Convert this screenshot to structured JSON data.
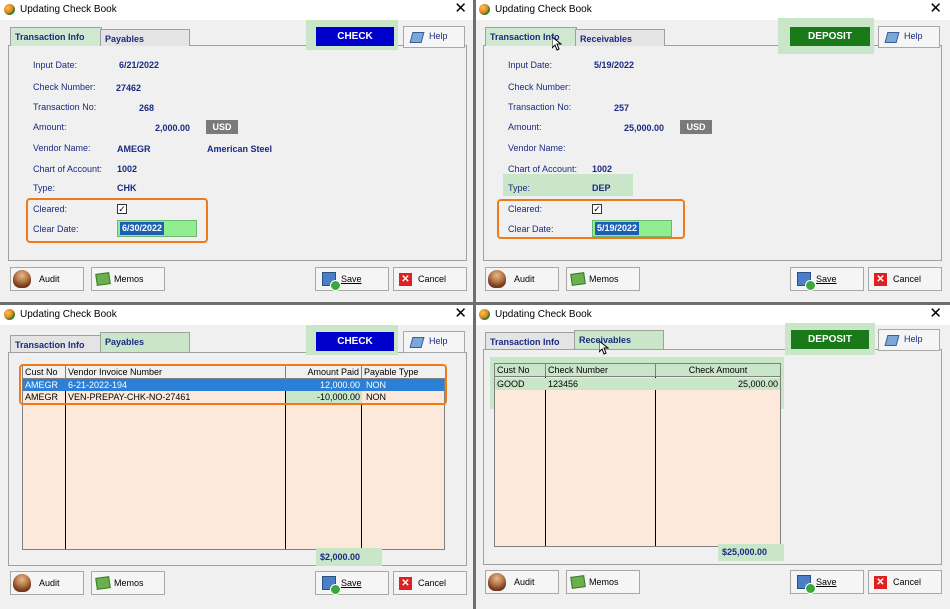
{
  "windows": [
    {
      "title": "Updating Check Book",
      "close": "✕",
      "tabs": [
        "Transaction Info",
        "Payables"
      ],
      "badge": "CHECK",
      "help": "Help",
      "fields": {
        "input_date_label": "Input Date:",
        "input_date": "6/21/2022",
        "check_number_label": "Check Number:",
        "check_number": "27462",
        "transaction_no_label": "Transaction No:",
        "transaction_no": "268",
        "amount_label": "Amount:",
        "amount": "2,000.00",
        "currency": "USD",
        "vendor_name_label": "Vendor Name:",
        "vendor_code": "AMEGR",
        "vendor_name": "American Steel",
        "chart_of_account_label": "Chart of Account:",
        "chart_of_account": "1002",
        "type_label": "Type:",
        "type": "CHK",
        "cleared_label": "Cleared:",
        "cleared": "✓",
        "clear_date_label": "Clear Date:",
        "clear_date": "6/30/2022"
      },
      "buttons": {
        "audit": "Audit",
        "memos": "Memos",
        "save": "Save",
        "cancel": "Cancel"
      }
    },
    {
      "title": "Updating Check Book",
      "close": "✕",
      "tabs": [
        "Transaction Info",
        "Receivables"
      ],
      "badge": "DEPOSIT",
      "help": "Help",
      "fields": {
        "input_date_label": "Input Date:",
        "input_date": "5/19/2022",
        "check_number_label": "Check Number:",
        "transaction_no_label": "Transaction No:",
        "transaction_no": "257",
        "amount_label": "Amount:",
        "amount": "25,000.00",
        "currency": "USD",
        "vendor_name_label": "Vendor Name:",
        "chart_of_account_label": "Chart of Account:",
        "chart_of_account": "1002",
        "type_label": "Type:",
        "type": "DEP",
        "cleared_label": "Cleared:",
        "cleared": "✓",
        "clear_date_label": "Clear Date:",
        "clear_date": "5/19/2022"
      },
      "buttons": {
        "audit": "Audit",
        "memos": "Memos",
        "save": "Save",
        "cancel": "Cancel"
      }
    },
    {
      "title": "Updating Check Book",
      "close": "✕",
      "tabs": [
        "Transaction Info",
        "Payables"
      ],
      "badge": "CHECK",
      "help": "Help",
      "grid": {
        "headers": [
          "Cust No",
          "Vendor Invoice Number",
          "Amount Paid",
          "Payable Type"
        ],
        "rows": [
          [
            "AMEGR",
            "6-21-2022-194",
            "12,000.00",
            "NON"
          ],
          [
            "AMEGR",
            "VEN-PREPAY-CHK-NO-27461",
            "-10,000.00",
            "NON"
          ]
        ],
        "total": "$2,000.00"
      },
      "buttons": {
        "audit": "Audit",
        "memos": "Memos",
        "save": "Save",
        "cancel": "Cancel"
      }
    },
    {
      "title": "Updating Check Book",
      "close": "✕",
      "tabs": [
        "Transaction Info",
        "Receivables"
      ],
      "badge": "DEPOSIT",
      "help": "Help",
      "grid": {
        "headers": [
          "Cust No",
          "Check Number",
          "Check Amount"
        ],
        "rows": [
          [
            "GOOD",
            "123456",
            "25,000.00"
          ]
        ],
        "total": "$25,000.00"
      },
      "buttons": {
        "audit": "Audit",
        "memos": "Memos",
        "save": "Save",
        "cancel": "Cancel"
      }
    }
  ],
  "colors": {
    "check_badge": "#0000cc",
    "deposit_badge": "#1a7a1a",
    "highlight": "#c9e6c9",
    "callout": "#f07a1a",
    "grid_bg": "#fde9dc"
  }
}
